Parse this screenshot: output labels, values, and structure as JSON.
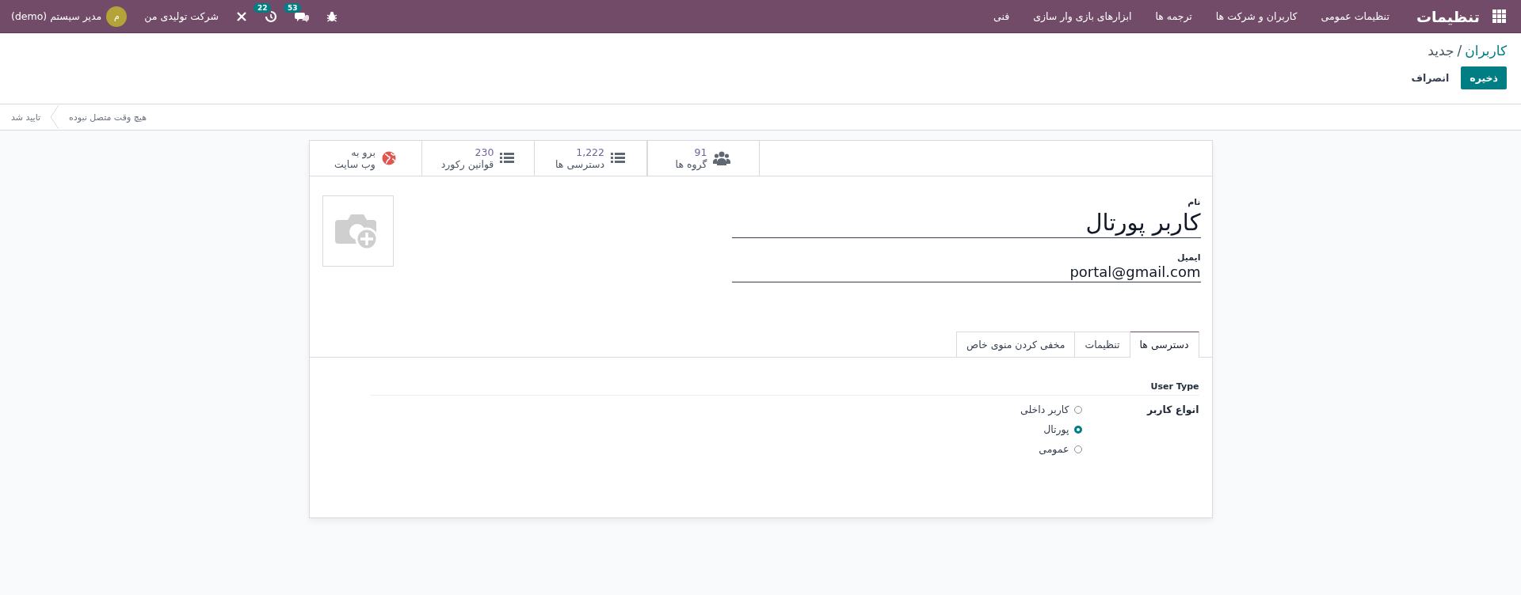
{
  "navbar": {
    "app_title": "تنظیمات",
    "menu": [
      "تنظیمات عمومی",
      "کاربران و شرکت ها",
      "ترجمه ها",
      "ابزارهای بازی وار سازی",
      "فنی"
    ],
    "messages_badge": "53",
    "activities_badge": "22",
    "company": "شرکت تولیدی من",
    "user_initial": "م",
    "user_name": "مدیر سیستم (demo)"
  },
  "breadcrumb": {
    "parent": "کاربران",
    "separator": "/",
    "current": "جدید"
  },
  "buttons": [
    {
      "kind": "primary",
      "label": "ذخیره"
    },
    {
      "kind": "secondary",
      "label": "انصراف"
    }
  ],
  "statusbar": [
    {
      "label": "هیچ وقت متصل نبوده",
      "selected": false
    },
    {
      "label": "تایید شد",
      "selected": false
    }
  ],
  "stat_buttons": [
    {
      "kind": "groups",
      "value": "91",
      "label": "گروه ها"
    },
    {
      "kind": "access",
      "value": "1,222",
      "label": "دسترسی ها"
    },
    {
      "kind": "rules",
      "value": "230",
      "label": "قوانین رکورد"
    },
    {
      "kind": "website",
      "value": "برو به",
      "label": "وب سایت"
    }
  ],
  "form": {
    "name_label": "نام",
    "name": "کاربر پورتال",
    "email_label": "ایمیل",
    "email": "portal@gmail.com"
  },
  "tabs": [
    {
      "label": "دسترسی ها",
      "selected": true
    },
    {
      "label": "تنظیمات",
      "selected": false
    },
    {
      "label": "مخفی کردن منوی خاص",
      "selected": false
    }
  ],
  "access_tab": {
    "section_title": "User Type",
    "field_label": "انواع کاربر",
    "options": [
      {
        "label": "کاربر داخلی",
        "selected": false
      },
      {
        "label": "پورتال",
        "selected": true
      },
      {
        "label": "عمومی",
        "selected": false
      }
    ]
  }
}
